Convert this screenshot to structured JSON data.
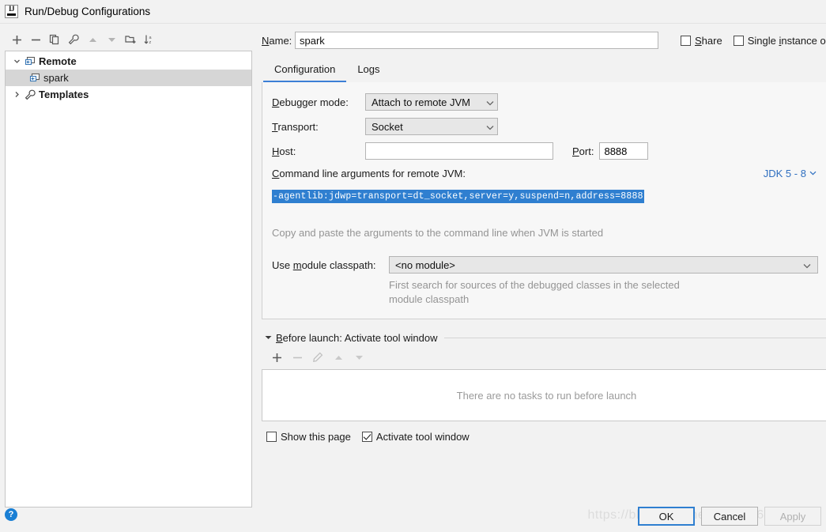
{
  "window": {
    "title": "Run/Debug Configurations",
    "app_icon": "intellij-idea-logo"
  },
  "sidebar": {
    "toolbar": [
      {
        "name": "add",
        "icon": "plus-icon",
        "enabled": true
      },
      {
        "name": "remove",
        "icon": "minus-icon",
        "enabled": true
      },
      {
        "name": "copy",
        "icon": "copy-icon",
        "enabled": true
      },
      {
        "name": "edit-templates",
        "icon": "wrench-icon",
        "enabled": true
      },
      {
        "name": "move-up",
        "icon": "arrow-up-icon",
        "enabled": false
      },
      {
        "name": "move-down",
        "icon": "arrow-down-icon",
        "enabled": false
      },
      {
        "name": "new-folder",
        "icon": "folder-add-icon",
        "enabled": true
      },
      {
        "name": "sort-alphabetically",
        "icon": "sort-az-icon",
        "enabled": true
      }
    ],
    "tree": [
      {
        "label": "Remote",
        "icon": "remote-debug-icon",
        "expanded": true,
        "twisty": "chevron-down-icon",
        "selected": false
      },
      {
        "label": "spark",
        "icon": "remote-debug-icon",
        "child": true,
        "selected": true
      },
      {
        "label": "Templates",
        "icon": "wrench-icon",
        "expanded": false,
        "twisty": "chevron-right-icon",
        "selected": false
      }
    ]
  },
  "header": {
    "name_label": "Name:",
    "name_value": "spark",
    "share_label": "Share",
    "share_checked": false,
    "single_instance_label": "Single instance on",
    "single_instance_checked": false
  },
  "tabs": [
    {
      "label": "Configuration",
      "active": true
    },
    {
      "label": "Logs",
      "active": false
    }
  ],
  "form": {
    "debugger_mode_label": "Debugger mode:",
    "debugger_mode_value": "Attach to remote JVM",
    "transport_label": "Transport:",
    "transport_value": "Socket",
    "host_label": "Host:",
    "host_value": "",
    "port_label": "Port:",
    "port_value": "8888",
    "cmd_label": "Command line arguments for remote JVM:",
    "jdk_link": "JDK 5 - 8",
    "cmd_value": "-agentlib:jdwp=transport=dt_socket,server=y,suspend=n,address=8888",
    "cmd_hint": "Copy and paste the arguments to the command line when JVM is started",
    "classpath_label": "Use module classpath:",
    "classpath_value": "<no module>",
    "classpath_hint_line1": "First search for sources of the debugged classes in the selected",
    "classpath_hint_line2": "module classpath"
  },
  "before_launch": {
    "title": "Before launch: Activate tool window",
    "expanded": true,
    "toolbar": [
      {
        "name": "add-task",
        "icon": "plus-icon",
        "enabled": true
      },
      {
        "name": "remove-task",
        "icon": "minus-icon",
        "enabled": false
      },
      {
        "name": "edit-task",
        "icon": "pencil-icon",
        "enabled": false
      },
      {
        "name": "move-task-up",
        "icon": "arrow-up-icon",
        "enabled": false
      },
      {
        "name": "move-task-down",
        "icon": "arrow-down-icon",
        "enabled": false
      }
    ],
    "empty_text": "There are no tasks to run before launch",
    "show_page_label": "Show this page",
    "show_page_checked": false,
    "activate_tool_window_label": "Activate tool window",
    "activate_tool_window_checked": true
  },
  "footer": {
    "help_icon": "help-icon",
    "ok_label": "OK",
    "cancel_label": "Cancel",
    "apply_label": "Apply",
    "apply_enabled": false
  },
  "watermark": "https://blog.csdn.net/sinat_26781639",
  "colors": {
    "accent": "#2f7fd0",
    "selection": "#2f7fd0",
    "tree_selection": "#d6d6d6",
    "link": "#2f6fc0",
    "hint_text": "#949494"
  }
}
